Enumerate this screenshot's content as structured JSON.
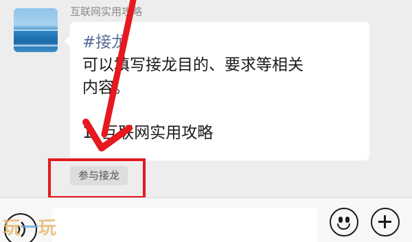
{
  "chat": {
    "sender_name": "互联网实用攻略",
    "message": {
      "tag": "#接龙",
      "line1": "可以填写接龙目的、要求等相关",
      "line2": "内容。",
      "line3": "1. 互联网实用攻略"
    },
    "join_button_label": "参与接龙"
  },
  "input_bar": {
    "placeholder": "",
    "voice_icon": "voice-icon",
    "emoji_icon": "emoji-icon",
    "plus_icon": "plus-icon"
  },
  "annotation": {
    "highlight_color": "#e5191f"
  },
  "watermark": {
    "left": "玩",
    "dash": "一",
    "right": "玩"
  }
}
